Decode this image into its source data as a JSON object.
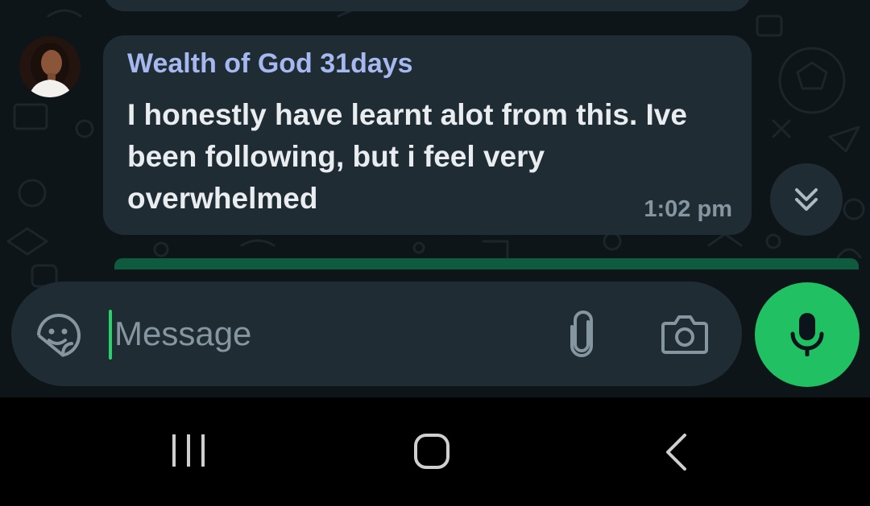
{
  "chat": {
    "message": {
      "sender": "Wealth of God 31days",
      "text": "I honestly have learnt alot from this. Ive been following, but i feel very overwhelmed",
      "time": "1:02 pm"
    }
  },
  "composer": {
    "placeholder": "Message"
  },
  "icons": {
    "emoji": "sticker-smiley-icon",
    "attach": "paperclip-icon",
    "camera": "camera-icon",
    "mic": "microphone-icon",
    "scroll": "double-chevron-down-icon",
    "nav_recents": "recent-apps-icon",
    "nav_home": "home-icon",
    "nav_back": "back-icon"
  },
  "colors": {
    "background": "#0b141a",
    "bubble": "#202c33",
    "sender_name": "#a6b8f0",
    "accent_green": "#21c063",
    "nav_bar": "#000000"
  }
}
